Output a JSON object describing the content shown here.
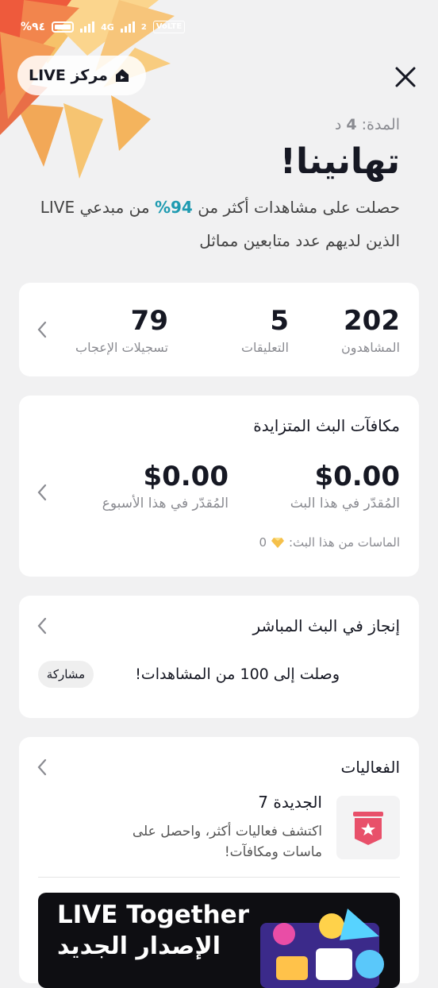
{
  "status_bar": {
    "battery": "%٩٤",
    "network": "4G",
    "volte": "VoLTE",
    "sim": "2"
  },
  "header": {
    "live_center_label": "مركز LIVE",
    "duration_label": "المدة:",
    "duration_value": "4",
    "duration_unit": "د",
    "congrats": "تهانينا!",
    "summary_before": "حصلت على مشاهدات أكثر من ",
    "summary_pct": "94%",
    "summary_after": " من مبدعي LIVE الذين لديهم عدد متابعين مماثل"
  },
  "stats": [
    {
      "value": "202",
      "label": "المشاهدون"
    },
    {
      "value": "5",
      "label": "التعليقات"
    },
    {
      "value": "79",
      "label": "تسجيلات الإعجاب"
    }
  ],
  "rewards": {
    "title": "مكافآت البث المتزايدة",
    "this_live_value": "$0.00",
    "this_live_label": "المُقدّر في هذا البث",
    "this_week_value": "$0.00",
    "this_week_label": "المُقدّر في هذا الأسبوع",
    "diamonds_label": "الماسات من هذا البث:",
    "diamonds_value": "0"
  },
  "achievement": {
    "title": "إنجاز في البث المباشر",
    "text": "وصلت إلى 100 من المشاهدات!",
    "share_label": "مشاركة"
  },
  "events": {
    "title": "الفعاليات",
    "item_title": "الجديدة 7",
    "item_desc": "اكتشف فعاليات أكثر، واحصل على ماسات ومكافآت!",
    "banner_line1": "LIVE Together",
    "banner_line2": "الإصدار الجديد"
  },
  "colors": {
    "accent": "#1f9bb1",
    "badge": "#e8506a"
  }
}
